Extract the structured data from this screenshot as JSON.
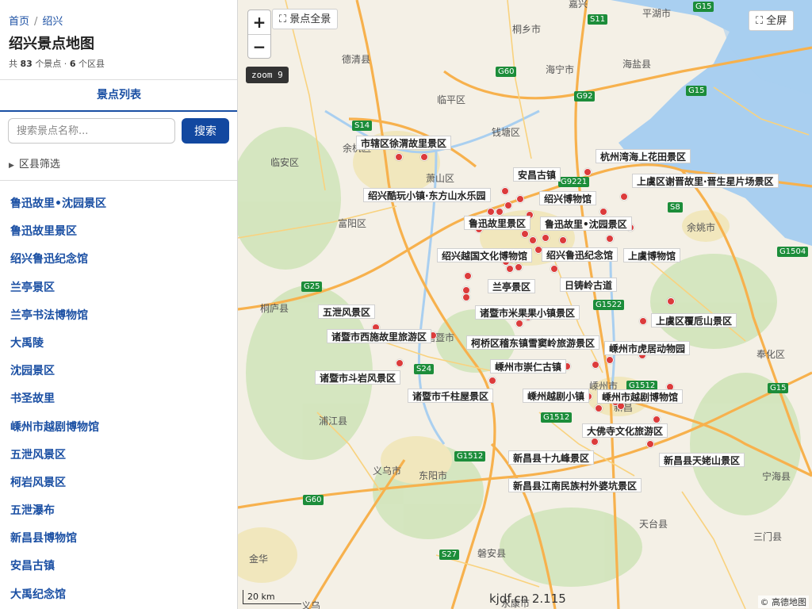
{
  "breadcrumb": {
    "home": "首页",
    "current": "绍兴"
  },
  "page": {
    "title": "绍兴景点地图",
    "summary_prefix": "共",
    "spot_count": "83",
    "summary_mid": "个景点 ·",
    "district_count": "6",
    "summary_suffix": "个区县"
  },
  "tab": {
    "label": "景点列表"
  },
  "search": {
    "placeholder": "搜索景点名称...",
    "button": "搜索"
  },
  "filter": {
    "label": "区县筛选"
  },
  "spots": [
    "鲁迅故里•沈园景区",
    "鲁迅故里景区",
    "绍兴鲁迅纪念馆",
    "兰亭景区",
    "兰亭书法博物馆",
    "大禹陵",
    "沈园景区",
    "书圣故里",
    "嵊州市越剧博物馆",
    "五泄风景区",
    "柯岩风景区",
    "五泄瀑布",
    "新昌县博物馆",
    "安昌古镇",
    "大禹纪念馆"
  ],
  "map": {
    "overview_button": "景点全景",
    "fullscreen_button": "全屏",
    "zoom_in": "+",
    "zoom_out": "−",
    "zoom_label": "zoom 9",
    "scale_label": "20 km",
    "watermark": "kjdf.cn 2.115",
    "attribution": "© 高德地图",
    "colors": {
      "marker": "#dc3b3b",
      "water": "#a9cff0",
      "green": "#cfe4b8",
      "urban": "#f1e7bd",
      "highway": "#f7b14d",
      "road": "#f9d27e",
      "shield": "#1c8d3a"
    },
    "labels": [
      "市辖区徐渭故里景区",
      "安昌古镇",
      "杭州湾海上花田景区",
      "绍兴酷玩小镇·东方山水乐园",
      "绍兴博物馆",
      "上虞区谢晋故里·晋生星片场景区",
      "鲁迅故里景区",
      "鲁迅故里•沈园景区",
      "绍兴越国文化博物馆",
      "绍兴鲁迅纪念馆",
      "上虞博物馆",
      "兰亭景区",
      "日铸岭古道",
      "五泄风景区",
      "诸暨市米果果小镇景区",
      "上虞区覆卮山景区",
      "诸暨市西施故里旅游区",
      "柯桥区稽东镇雪窦岭旅游景区",
      "嵊州市虎居动物园",
      "嵊州市崇仁古镇",
      "诸暨市斗岩风景区",
      "诸暨市千柱屋景区",
      "嵊州越剧小镇",
      "嵊州市越剧博物馆",
      "大佛寺文化旅游区",
      "新昌县十九峰景区",
      "新昌县天姥山景区",
      "新昌县江南民族村外婆坑景区"
    ],
    "towns": [
      "嘉兴",
      "平湖市",
      "桐乡市",
      "德清县",
      "海宁市",
      "海盐县",
      "临平区",
      "钱塘区",
      "余杭区",
      "临安区",
      "萧山区",
      "富阳区",
      "余姚市",
      "桐庐县",
      "诸暨市",
      "嵊州市",
      "奉化区",
      "浦江县",
      "义乌市",
      "东阳市",
      "新昌",
      "天台县",
      "宁海县",
      "三门县",
      "磐安县",
      "金华",
      "永康市",
      "义乌"
    ],
    "routes": [
      "S11",
      "G15",
      "G60",
      "G92",
      "S14",
      "G9221",
      "S8",
      "G1504",
      "G25",
      "G1522",
      "S24",
      "G1512",
      "G1512",
      "G1512",
      "G60",
      "S27",
      "G15",
      "G15"
    ]
  }
}
